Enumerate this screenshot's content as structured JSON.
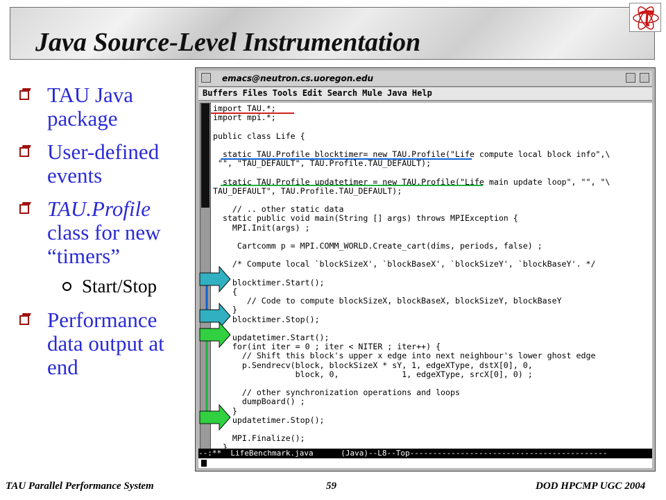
{
  "slide": {
    "title": "Java Source-Level Instrumentation",
    "logo_icon": "tau-symbol-icon"
  },
  "bullets": [
    {
      "text": "TAU Java package",
      "italic": false
    },
    {
      "text": "User-defined events",
      "italic": false
    },
    {
      "text": "TAU.Profile",
      "suffix": "class for new “timers”",
      "italic": true
    },
    {
      "text": "Performance data output at end",
      "italic": false
    }
  ],
  "sub_bullet": "Start/Stop",
  "emacs": {
    "title": "emacs@neutron.cs.uoregon.edu",
    "menu": [
      "Buffers",
      "Files",
      "Tools",
      "Edit",
      "Search",
      "Mule",
      "Java",
      "Help"
    ],
    "code_lines": [
      "import TAU.*;",
      "import mpi.*;",
      "",
      "public class Life {",
      "",
      "  static TAU.Profile blocktimer= new TAU.Profile(\"Life compute local block info\",\\",
      " \"\", \"TAU_DEFAULT\", TAU.Profile.TAU_DEFAULT);",
      "",
      "  static TAU.Profile updatetimer = new TAU.Profile(\"Life main update loop\", \"\", \"\\",
      "TAU_DEFAULT\", TAU.Profile.TAU_DEFAULT);",
      "",
      "    // .. other static data",
      "  static public void main(String [] args) throws MPIException {",
      "    MPI.Init(args) ;",
      "",
      "     Cartcomm p = MPI.COMM_WORLD.Create_cart(dims, periods, false) ;",
      "",
      "    /* Compute local `blockSizeX', `blockBaseX', `blockSizeY', `blockBaseY'. */",
      "",
      "    blocktimer.Start();",
      "    {",
      "       // Code to compute blockSizeX, blockBaseX, blockSizeY, blockBaseY",
      "    }",
      "    blocktimer.Stop();",
      "",
      "    updatetimer.Start();",
      "    for(int iter = 0 ; iter < NITER ; iter++) {",
      "      // Shift this block's upper x edge into next neighbour's lower ghost edge",
      "      p.Sendrecv(block, blockSizeX * sY, 1, edgeXType, dstX[0], 0,",
      "                 block, 0,             1, edgeXType, srcX[0], 0) ;",
      "",
      "      // other synchronization operations and loops",
      "      dumpBoard() ;",
      "    }",
      "    updatetimer.Stop();",
      "",
      "    MPI.Finalize();",
      "  }"
    ],
    "modeline": "--:**  LifeBenchmark.java      (Java)--L8--Top-------------------------------------------"
  },
  "footer": {
    "left": "TAU Parallel Performance System",
    "page": "59",
    "right": "DOD HPCMP UGC 2004"
  },
  "colors": {
    "bullet_text": "#2a2ad6",
    "bullet_box": "#a01010",
    "underline_red": "#d02020",
    "underline_blue": "#1060d0",
    "underline_green": "#20b040",
    "arrow_teal": "#30b0c0",
    "arrow_green": "#30d040"
  }
}
